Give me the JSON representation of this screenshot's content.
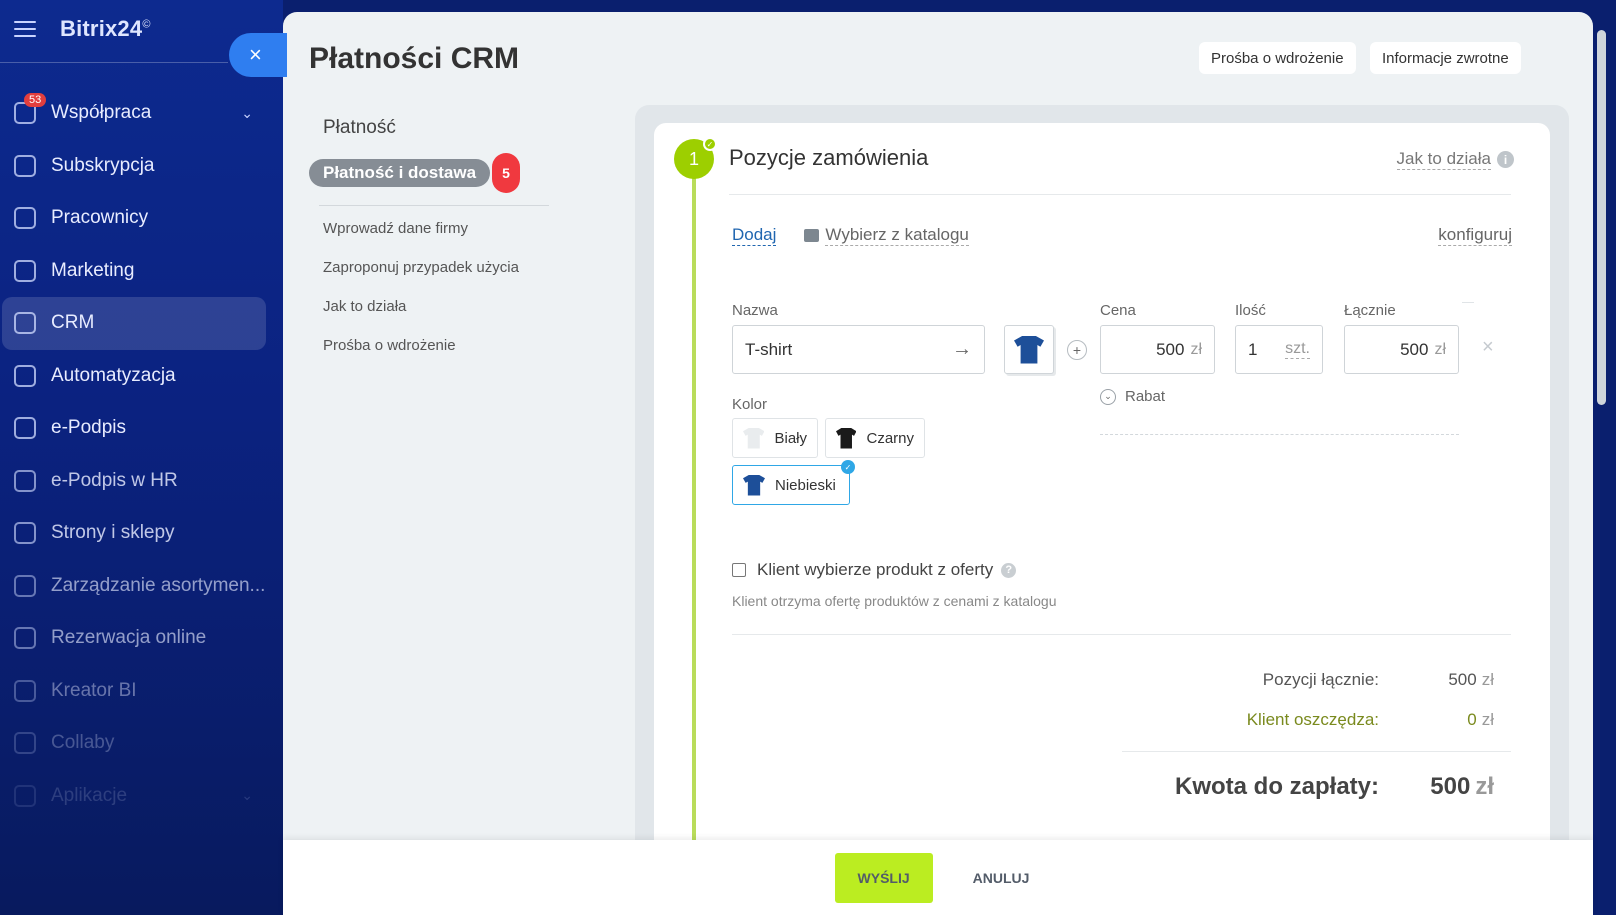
{
  "sidebar": {
    "logo": "Bitrix24",
    "logo_mark": "©",
    "items": [
      {
        "label": "Współpraca",
        "badge": "53",
        "chevron": "⌄"
      },
      {
        "label": "Subskrypcja"
      },
      {
        "label": "Pracownicy"
      },
      {
        "label": "Marketing"
      },
      {
        "label": "CRM"
      },
      {
        "label": "Automatyzacja"
      },
      {
        "label": "e-Podpis"
      },
      {
        "label": "e-Podpis w HR"
      },
      {
        "label": "Strony i sklepy"
      },
      {
        "label": "Zarządzanie asortymen..."
      },
      {
        "label": "Rezerwacja online"
      },
      {
        "label": "Kreator BI"
      },
      {
        "label": "Collaby"
      },
      {
        "label": "Aplikacje",
        "chevron": "⌄"
      }
    ]
  },
  "panel": {
    "title": "Płatności CRM",
    "top_buttons": {
      "implementation": "Prośba o wdrożenie",
      "feedback": "Informacje zwrotne"
    },
    "close_icon": "×"
  },
  "left_menu": {
    "heading": "Płatność",
    "active_item": "Płatność i dostawa",
    "active_count": "5",
    "links": [
      "Wprowadź dane firmy",
      "Zaproponuj przypadek użycia",
      "Jak to działa",
      "Prośba o wdrożenie"
    ]
  },
  "order": {
    "step_number": "1",
    "title": "Pozycje zamówienia",
    "how_it_works": "Jak to działa",
    "toolbar": {
      "add": "Dodaj",
      "catalog": "Wybierz z katalogu",
      "configure": "konfiguruj"
    },
    "labels": {
      "name": "Nazwa",
      "price": "Cena",
      "quantity": "Ilość",
      "total": "Łącznie",
      "color": "Kolor"
    },
    "product": {
      "name": "T-shirt",
      "price": "500",
      "currency": "zł",
      "quantity": "1",
      "unit": "szt.",
      "total": "500"
    },
    "discount_label": "Rabat",
    "colors": [
      {
        "label": "Biały",
        "selected": false
      },
      {
        "label": "Czarny",
        "selected": false
      },
      {
        "label": "Niebieski",
        "selected": true
      }
    ],
    "offer_checkbox": {
      "label": "Klient wybierze produkt z oferty",
      "hint": "Klient otrzyma ofertę produktów z cenami z katalogu",
      "checked": false
    },
    "summary": {
      "items_total_label": "Pozycji łącznie:",
      "items_total_value": "500",
      "savings_label": "Klient oszczędza:",
      "savings_value": "0",
      "to_pay_label": "Kwota do zapłaty:",
      "to_pay_value": "500",
      "currency": "zł"
    }
  },
  "footer": {
    "send": "WYŚLIJ",
    "cancel": "ANULUJ"
  },
  "colors": {
    "accent_green": "#bbed21",
    "step_green": "#9dcf00",
    "link_blue": "#2066b0",
    "badge_red": "#f0393f",
    "sidebar_blue": "#0d2a8f"
  }
}
